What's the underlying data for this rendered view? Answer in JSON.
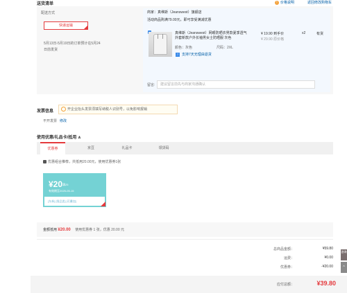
{
  "section": {
    "title": "送货清单",
    "help": "价格说明",
    "return_cart": "返回修改购物车"
  },
  "shipping": {
    "title": "配送方式",
    "express": "快递运输",
    "delivery": "5月13日-5月19日的订单预计在5月24",
    "delivery_note": "日前发货"
  },
  "goods": {
    "seller": "商家：真维斯（Jeanswest）旗舰店",
    "promo": "活动商品购满79.00元，即可享受满减优惠",
    "name": "真维斯（Jeanswest）网眼防晒衣男款夏季透气外套新款户外长袖男女士防晒服 灰色",
    "color": "颜色：灰色",
    "size": "尺码：2XL",
    "return_policy": "支持7天无理由退货",
    "price": "¥ 19.90 到手价",
    "orig_price": "¥ 29.90 原价格",
    "qty": "x2",
    "stock": "有货",
    "remark_label": "留言:",
    "remark_placeholder": "建议留言前先与商家沟通确认"
  },
  "invoice": {
    "title": "发票信息",
    "tip": "开企业抬头发票须填写纳税人识别号，以免影响报销",
    "status": "不开发票",
    "edit": "修改"
  },
  "coupon": {
    "title": "使用优惠/礼品卡/抵用 ∧",
    "tabs": [
      "优惠券",
      "京豆",
      "礼品卡",
      "领货码"
    ],
    "combo_text": "优惠组合推荐，共抵用20.00元，使用优惠券1张",
    "card": {
      "amount": "¥20",
      "condition": "满25",
      "expire": "有效期至2025-05-15",
      "tags": "[东券] [限品类] [可叠加]"
    },
    "summary_label": "金额抵用",
    "summary_amount": "¥20.00",
    "summary_rest": "使用优惠券 1 张，优惠 20.00 元"
  },
  "totals": {
    "rows": [
      {
        "label": "总商品金额：",
        "value": "¥59.80"
      },
      {
        "label": "运费：",
        "value": "¥0.00"
      },
      {
        "label": "优惠券：",
        "value": "-¥20.00"
      }
    ],
    "pay_label": "应付总额：",
    "pay_value": "¥39.80"
  },
  "side": {
    "btn1": "咨询",
    "btn2": "^"
  },
  "colors": {
    "accent": "#e4393c",
    "coupon": "#74d2d4",
    "link": "#005ea7"
  }
}
